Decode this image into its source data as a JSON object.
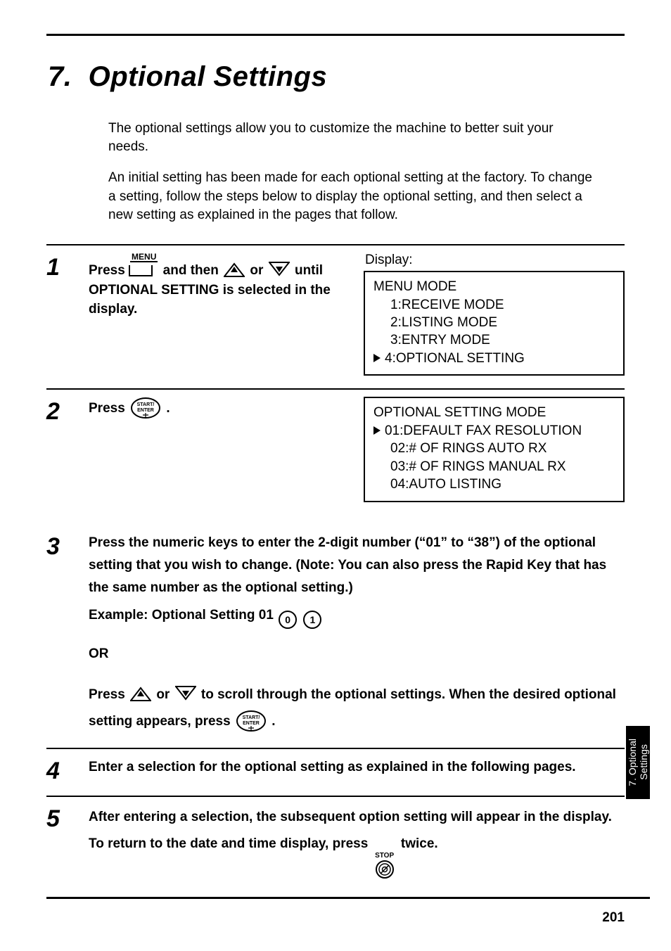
{
  "chapter": {
    "number": "7.",
    "title": "Optional Settings"
  },
  "intro1": "The optional settings allow you to customize the machine to better suit your needs.",
  "intro2": "An initial setting has been made for each optional setting at the factory. To change a setting, follow the steps below to display the optional setting, and then select a new setting as explained in the pages that follow.",
  "steps": {
    "s1": {
      "prefix": "Press ",
      "menu_label": "MENU",
      "mid1": " and then ",
      "mid2": " or ",
      "suffix": " until OPTIONAL SETTING is selected in the display."
    },
    "s2": {
      "prefix": "Press ",
      "suffix": "."
    },
    "s3": {
      "line1": "Press the numeric keys to enter the 2-digit number (“01” to “38”) of the optional setting that you wish to change. (Note: You can also press the Rapid Key that has the same number as the optional setting.)",
      "example_prefix": "Example: Optional Setting 01  ",
      "key0": "0",
      "key1": "1",
      "or": "OR",
      "line2a": "Press ",
      "line2b": " or ",
      "line2c": " to scroll through the optional settings. When the desired optional setting appears, press ",
      "line2d": "."
    },
    "s4": "Enter a selection for the optional setting as explained in the following pages.",
    "s5a": "After entering a selection, the subsequent option setting will appear in the display. To return to the date and time display, press ",
    "s5b": " twice.",
    "stop_label": "STOP"
  },
  "display1": {
    "label": "Display:",
    "title": "MENU MODE",
    "l1": "1:RECEIVE MODE",
    "l2": "2:LISTING MODE",
    "l3": "3:ENTRY MODE",
    "l4": "4:OPTIONAL SETTING"
  },
  "display2": {
    "title": "OPTIONAL SETTING MODE",
    "l1": "01:DEFAULT FAX RESOLUTION",
    "l2": "02:# OF RINGS AUTO RX",
    "l3": "03:# OF RINGS MANUAL RX",
    "l4": "04:AUTO LISTING"
  },
  "icons": {
    "up": "up-arrow-key-icon",
    "down": "down-arrow-key-icon",
    "start_enter": "start-enter-key-icon",
    "stop": "stop-key-icon"
  },
  "se_label_top": "START/",
  "se_label_bot": "ENTER",
  "sidetab": "7. Optional\nSettings",
  "page_number": "201"
}
